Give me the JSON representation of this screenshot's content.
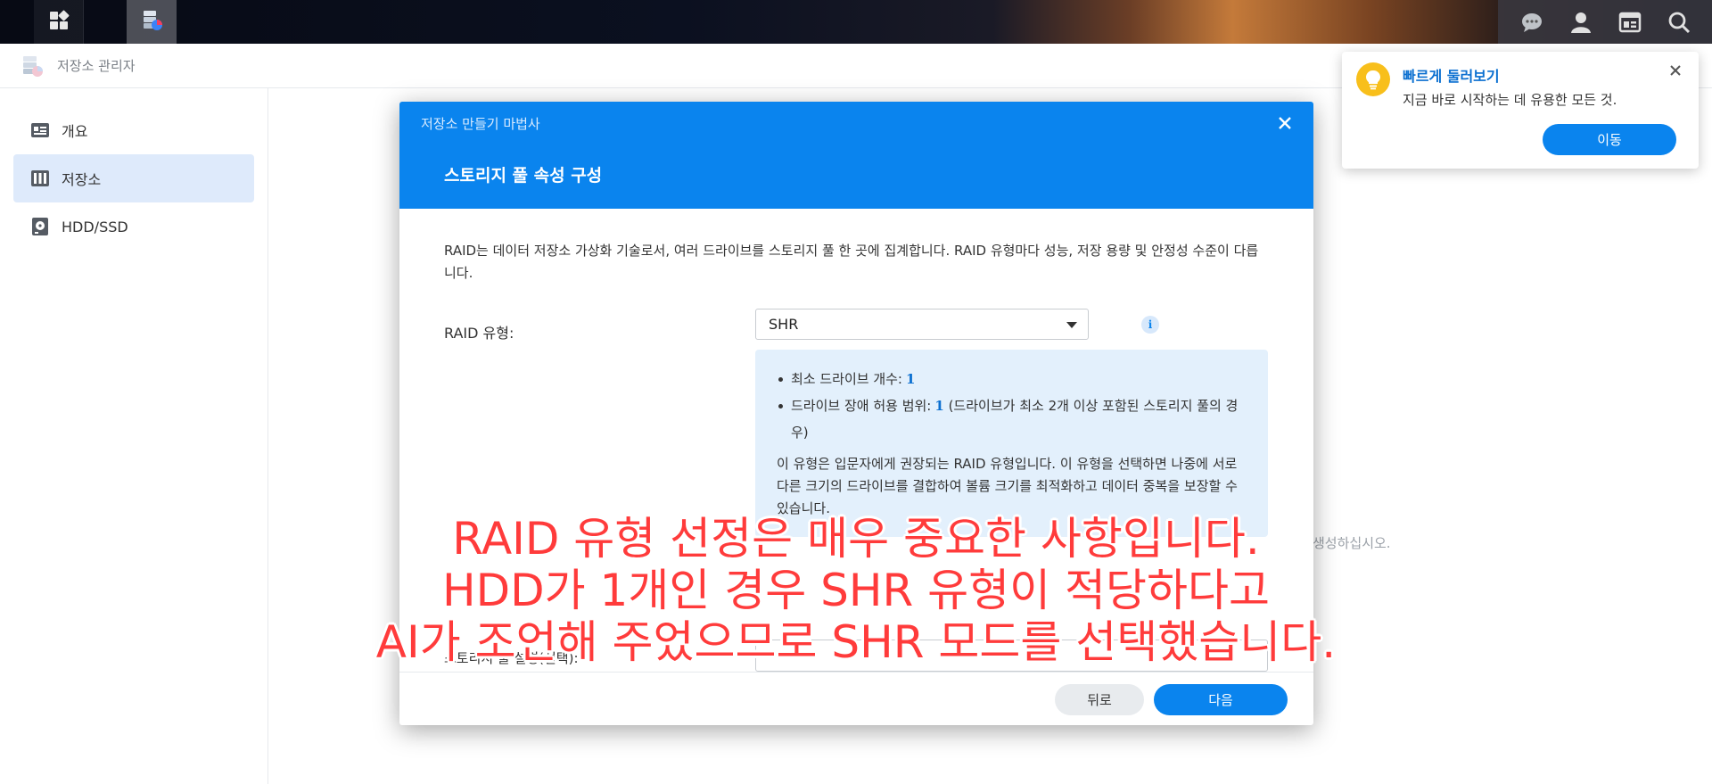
{
  "taskbar": {
    "apps_icon": "grid-icon",
    "storage_icon": "storage-manager-icon",
    "right_icons": [
      "chat-icon",
      "user-icon",
      "widget-icon",
      "search-icon"
    ]
  },
  "window": {
    "title": "저장소 관리자",
    "sidebar": {
      "items": [
        {
          "label": "개요",
          "icon": "overview-icon"
        },
        {
          "label": "저장소",
          "icon": "storage-icon"
        },
        {
          "label": "HDD/SSD",
          "icon": "hdd-icon"
        }
      ]
    },
    "content_hint": "생성하십시오."
  },
  "dialog": {
    "wizard_title": "저장소 만들기 마법사",
    "step_title": "스토리지 풀 속성 구성",
    "description": "RAID는 데이터 저장소 가상화 기술로서, 여러 드라이브를 스토리지 풀 한 곳에 집계합니다. RAID 유형마다 성능, 저장 용량 및 안정성 수준이 다릅니다.",
    "raid_type_label": "RAID 유형:",
    "raid_type_value": "SHR",
    "info": {
      "min_drives_label": "최소 드라이브 개수:",
      "min_drives_value": "1",
      "fault_tolerance_label": "드라이브 장애 허용 범위:",
      "fault_tolerance_value": "1",
      "fault_tolerance_note": "(드라이브가 최소 2개 이상 포함된 스토리지 풀의 경우)",
      "paragraph": "이 유형은 입문자에게 권장되는 RAID 유형입니다. 이 유형을 선택하면 나중에 서로 다른 크기의 드라이브를 결합하여 볼륨 크기를 최적화하고 데이터 중복을 보장할 수 있습니다."
    },
    "pool_description_label": "스토리지 풀 설명(선택):",
    "back_label": "뒤로",
    "next_label": "다음"
  },
  "toast": {
    "title": "빠르게 둘러보기",
    "text": "지금 바로 시작하는 데 유용한 모든 것.",
    "button": "이동"
  },
  "caption": {
    "line1": "RAID 유형 선정은 매우 중요한 사항입니다.",
    "line2": "HDD가 1개인 경우 SHR 유형이 적당하다고",
    "line3": "AI가 조언해 주었으므로 SHR 모드를 선택했습니다."
  },
  "colors": {
    "accent": "#0a84ee",
    "caption": "#ff3b3b",
    "toast_bulb": "#f8bf1b",
    "sidebar_active": "#deeafb"
  }
}
